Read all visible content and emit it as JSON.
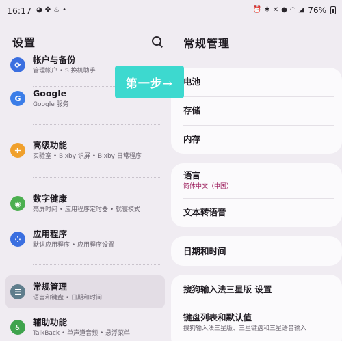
{
  "status_bar": {
    "time": "16:17",
    "left_icons": [
      "qq-icon",
      "paw-icon",
      "fire-icon",
      "dot-icon"
    ],
    "right_icons": [
      "alarm-icon",
      "bluetooth-icon",
      "mute-icon",
      "location-icon",
      "wifi-icon",
      "signal-icon"
    ],
    "battery": "76%"
  },
  "left_pane": {
    "title": "设置",
    "items": [
      {
        "label": "帐户与备份",
        "sub": "管理帐户 • S 换机助手",
        "icon": "sync-icon",
        "color": "#3b6fe0"
      },
      {
        "label": "Google",
        "sub": "Google 服务",
        "icon": "google-icon",
        "color": "#3b7de8"
      },
      {
        "label": "高级功能",
        "sub": "实验室 • Bixby 识屏 • Bixby 日常程序",
        "icon": "advanced-features-icon",
        "color": "#f0a02c"
      },
      {
        "label": "数字健康",
        "sub": "亮屏时间 • 应用程序定时器 • 就寝模式",
        "icon": "digital-wellbeing-icon",
        "color": "#4caf50"
      },
      {
        "label": "应用程序",
        "sub": "默认应用程序 • 应用程序设置",
        "icon": "apps-icon",
        "color": "#3b6fe0"
      },
      {
        "label": "常规管理",
        "sub": "语言和键盘 • 日期和时间",
        "icon": "sliders-icon",
        "color": "#5f7d8c"
      },
      {
        "label": "辅助功能",
        "sub": "TalkBack • 单声道音频 • 悬浮菜单",
        "icon": "accessibility-icon",
        "color": "#3fa34d"
      }
    ]
  },
  "right_pane": {
    "title": "常规管理",
    "cards": [
      {
        "rows": [
          {
            "label": "电池"
          },
          {
            "label": "存储"
          },
          {
            "label": "内存"
          }
        ]
      },
      {
        "rows": [
          {
            "label": "语言",
            "sub": "简体中文（中国）"
          },
          {
            "label": "文本转语音"
          }
        ]
      },
      {
        "rows": [
          {
            "label": "日期和时间"
          }
        ]
      },
      {
        "rows": [
          {
            "label": "搜狗输入法三星版 设置"
          },
          {
            "label": "键盘列表和默认值",
            "sub": "搜狗输入法三星版、三星键盘和三星语音输入"
          }
        ]
      }
    ]
  },
  "overlay": {
    "text": "第一步→",
    "color": "#3dd9cf"
  }
}
